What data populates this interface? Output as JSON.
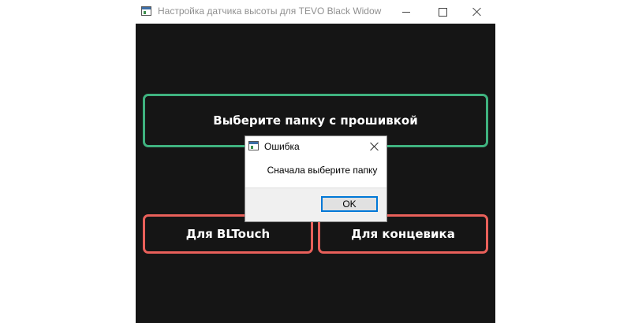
{
  "window": {
    "title": "Настройка датчика высоты для TEVO Black Widow",
    "background": "#151515"
  },
  "buttons": {
    "select_folder": {
      "label": "Выберите папку с прошивкой",
      "border_color": "#3fb27f"
    },
    "bltouch": {
      "label": "Для BLTouch",
      "border_color": "#e9605a"
    },
    "endstop": {
      "label": "Для концевика",
      "border_color": "#e9605a"
    }
  },
  "dialog": {
    "title": "Ошибка",
    "message": "Сначала выберите папку",
    "ok_label": "OK",
    "ok_border": "#0078d7"
  },
  "icons": {
    "app": "app-window-icon",
    "minimize": "minimize-icon",
    "maximize": "maximize-icon",
    "close": "close-icon"
  }
}
